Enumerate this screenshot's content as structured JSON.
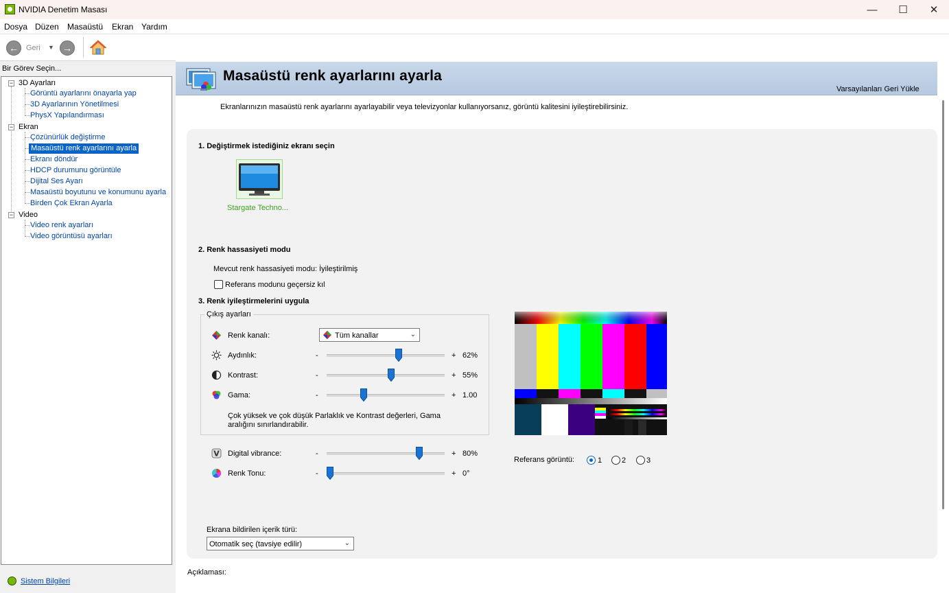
{
  "window": {
    "title": "NVIDIA Denetim Masası",
    "minimize": "—",
    "maximize": "☐",
    "close": "✕"
  },
  "menu": [
    "Dosya",
    "Düzen",
    "Masaüstü",
    "Ekran",
    "Yardım"
  ],
  "toolbar": {
    "back_label": "Geri"
  },
  "sidebar": {
    "task_label": "Bir Görev Seçin...",
    "groups": [
      {
        "label": "3D Ayarları",
        "items": [
          "Görüntü ayarlarını önayarla yap",
          "3D Ayarlarının Yönetilmesi",
          "PhysX Yapılandırması"
        ]
      },
      {
        "label": "Ekran",
        "items": [
          "Çözünürlük değiştirme",
          "Masaüstü renk ayarlarını ayarla",
          "Ekranı döndür",
          "HDCP durumunu görüntüle",
          "Dijital Ses Ayarı",
          "Masaüstü boyutunu ve konumunu ayarla",
          "Birden Çok Ekran Ayarla"
        ]
      },
      {
        "label": "Video",
        "items": [
          "Video renk ayarları",
          "Video görüntüsü ayarları"
        ]
      }
    ],
    "system_info": "Sistem Bilgileri"
  },
  "page": {
    "title": "Masaüstü renk ayarlarını ayarla",
    "restore_defaults": "Varsayılanları Geri Yükle",
    "description": "Ekranlarınızın masaüstü renk ayarlarını ayarlayabilir veya televizyonlar kullanıyorsanız, görüntü kalitesini iyileştirebilirsiniz.",
    "section1": {
      "title": "1. Değiştirmek istediğiniz ekranı seçin",
      "display_name": "Stargate Techno..."
    },
    "section2": {
      "title": "2. Renk hassasiyeti modu",
      "current_mode": "Mevcut renk hassasiyeti modu: İyileştirilmiş",
      "override_label": "Referans modunu geçersiz kıl",
      "override_checked": false
    },
    "section3": {
      "title": "3. Renk iyileştirmelerini uygula",
      "group_label": "Çıkış ayarları",
      "channel_label": "Renk kanalı:",
      "channel_value": "Tüm kanallar",
      "sliders": [
        {
          "label": "Aydınlık:",
          "minus": "-",
          "plus": "+",
          "value_text": "62%",
          "value": 0.62,
          "icon": "sun-icon"
        },
        {
          "label": "Kontrast:",
          "minus": "-",
          "plus": "+",
          "value_text": "55%",
          "value": 0.55,
          "icon": "contrast-icon"
        },
        {
          "label": "Gama:",
          "minus": "-",
          "plus": "+",
          "value_text": "1.00",
          "value": 0.3,
          "icon": "gamma-icon"
        }
      ],
      "warning": [
        "Çok yüksek ve çok düşük Parlaklık ve Kontrast değerleri, Gama",
        "aralığını sınırlandırabilir."
      ],
      "extra_sliders": [
        {
          "label": "Digital vibrance:",
          "minus": "-",
          "plus": "+",
          "value_text": "80%",
          "value": 0.8,
          "icon": "vibrance-icon"
        },
        {
          "label": "Renk Tonu:",
          "minus": "-",
          "plus": "+",
          "value_text": "0°",
          "value": 0.0,
          "icon": "hue-icon"
        }
      ]
    },
    "reference": {
      "label": "Referans görüntü:",
      "options": [
        "1",
        "2",
        "3"
      ],
      "selected": "1"
    },
    "content_type": {
      "label": "Ekrana bildirilen içerik türü:",
      "value": "Otomatik seç (tavsiye edilir)"
    },
    "description_label": "Açıklaması:"
  },
  "colors": {
    "accent": "#0a64c8",
    "nvidia_green": "#76b900",
    "header_band": "#c0d2e7"
  }
}
